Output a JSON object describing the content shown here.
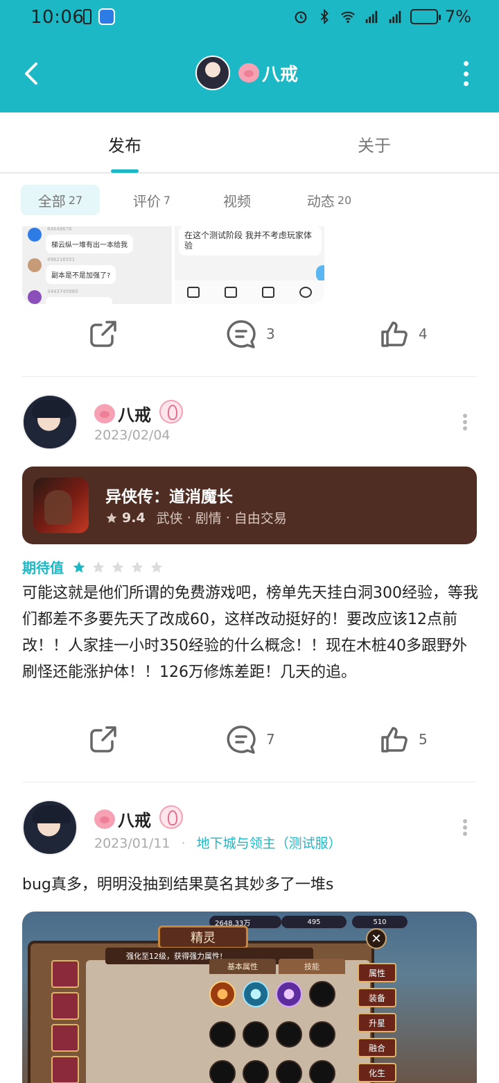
{
  "status_bar": {
    "time": "10:06",
    "battery": "7%"
  },
  "header": {
    "username": "八戒"
  },
  "tabs": [
    {
      "label": "发布"
    },
    {
      "label": "关于"
    }
  ],
  "filters": [
    {
      "label": "全部",
      "count": "27"
    },
    {
      "label": "评价",
      "count": "7"
    },
    {
      "label": "视频",
      "count": ""
    },
    {
      "label": "动态",
      "count": "20"
    }
  ],
  "preview_post": {
    "thumb_left": {
      "msgs": [
        {
          "uid": "84648676",
          "text": "梯云纵一堆有出一本给我"
        },
        {
          "uid": "498216551",
          "text": "副本是不是加强了?"
        },
        {
          "uid": "3443745880",
          "text": ""
        }
      ]
    },
    "thumb_right": {
      "text": "在这个测试阶段 我并不考虑玩家体验"
    },
    "comments": "3",
    "likes": "4"
  },
  "post1": {
    "username": "八戒",
    "date": "2023/02/04",
    "game": {
      "name": "异侠传：道消魔长",
      "rating": "9.4",
      "tags": [
        "武侠",
        "剧情",
        "自由交易"
      ]
    },
    "rating_label": "期待值",
    "stars": 1,
    "text": "可能这就是他们所谓的免费游戏吧，榜单先天挂白洞300经验，等我们都差不多要先天了改成60，这样改动挺好的！要改应该12点前改！！人家挂一小时350经验的什么概念！！现在木桩40多跟野外刷怪还能涨护体！！126万修炼差距！几天的追。",
    "comments": "7",
    "likes": "5"
  },
  "post2": {
    "username": "八戒",
    "date": "2023/01/11",
    "game": "地下城与领主（测试服）",
    "text": "bug真多，明明没抽到结果莫名其妙多了一堆s",
    "screenshot": {
      "title": "精灵",
      "tip": "强化至12级，获得强力属性!",
      "gold": "2648.33万",
      "gems": "495",
      "hearts": "510",
      "tab1": "基本属性",
      "tab2": "技能",
      "side_buttons": [
        "属性",
        "装备",
        "升星",
        "融合",
        "化生"
      ]
    }
  },
  "colors": {
    "accent": "#1cb8c5",
    "card_bg": "#4f2d22"
  }
}
